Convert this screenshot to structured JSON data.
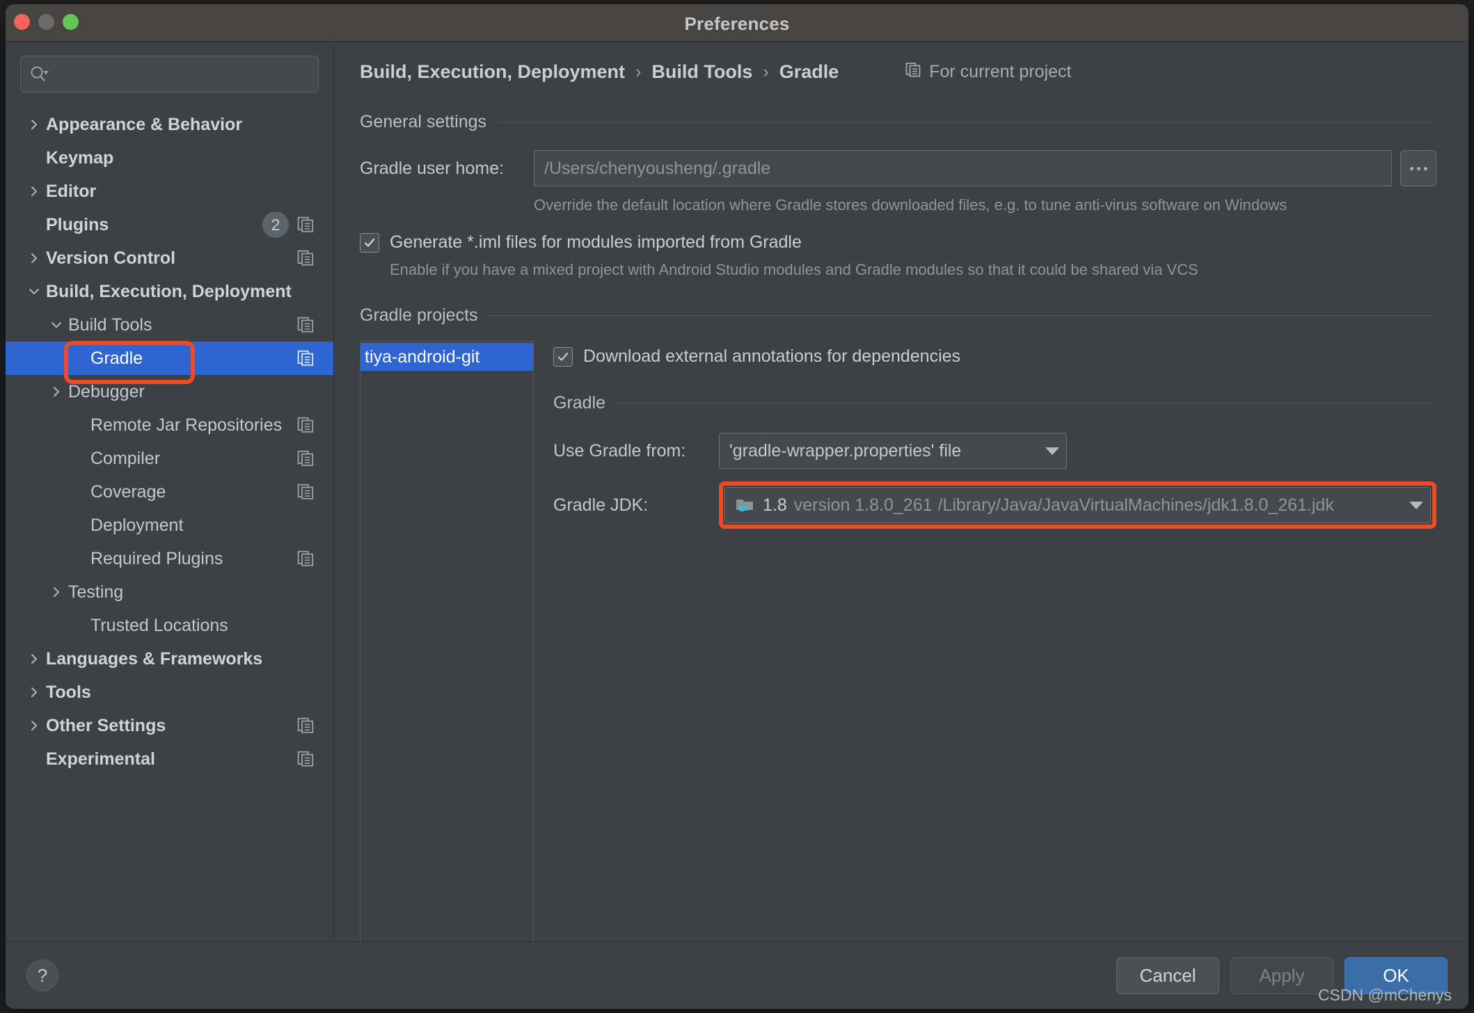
{
  "window": {
    "title": "Preferences",
    "traffic_lights": [
      "close-red",
      "minimize-gray",
      "zoom-green"
    ]
  },
  "sidebar": {
    "search": {
      "placeholder": "",
      "value": "",
      "icon": "search-icon"
    },
    "items": [
      {
        "label": "Appearance & Behavior",
        "arrow": "right",
        "indent": 0,
        "bold": true,
        "copy_icon": false,
        "badge": null,
        "selected": false
      },
      {
        "label": "Keymap",
        "arrow": "none",
        "indent": 0,
        "bold": true,
        "copy_icon": false,
        "badge": null,
        "selected": false
      },
      {
        "label": "Editor",
        "arrow": "right",
        "indent": 0,
        "bold": true,
        "copy_icon": false,
        "badge": null,
        "selected": false
      },
      {
        "label": "Plugins",
        "arrow": "none",
        "indent": 0,
        "bold": true,
        "copy_icon": true,
        "badge": "2",
        "selected": false
      },
      {
        "label": "Version Control",
        "arrow": "right",
        "indent": 0,
        "bold": true,
        "copy_icon": true,
        "badge": null,
        "selected": false
      },
      {
        "label": "Build, Execution, Deployment",
        "arrow": "down",
        "indent": 0,
        "bold": true,
        "copy_icon": false,
        "badge": null,
        "selected": false
      },
      {
        "label": "Build Tools",
        "arrow": "down",
        "indent": 1,
        "bold": false,
        "copy_icon": true,
        "badge": null,
        "selected": false
      },
      {
        "label": "Gradle",
        "arrow": "none",
        "indent": 2,
        "bold": false,
        "copy_icon": true,
        "badge": null,
        "selected": true
      },
      {
        "label": "Debugger",
        "arrow": "right",
        "indent": 1,
        "bold": false,
        "copy_icon": false,
        "badge": null,
        "selected": false
      },
      {
        "label": "Remote Jar Repositories",
        "arrow": "none",
        "indent": 2,
        "bold": false,
        "copy_icon": true,
        "badge": null,
        "selected": false
      },
      {
        "label": "Compiler",
        "arrow": "none",
        "indent": 2,
        "bold": false,
        "copy_icon": true,
        "badge": null,
        "selected": false
      },
      {
        "label": "Coverage",
        "arrow": "none",
        "indent": 2,
        "bold": false,
        "copy_icon": true,
        "badge": null,
        "selected": false
      },
      {
        "label": "Deployment",
        "arrow": "none",
        "indent": 2,
        "bold": false,
        "copy_icon": false,
        "badge": null,
        "selected": false
      },
      {
        "label": "Required Plugins",
        "arrow": "none",
        "indent": 2,
        "bold": false,
        "copy_icon": true,
        "badge": null,
        "selected": false
      },
      {
        "label": "Testing",
        "arrow": "right",
        "indent": 1,
        "bold": false,
        "copy_icon": false,
        "badge": null,
        "selected": false
      },
      {
        "label": "Trusted Locations",
        "arrow": "none",
        "indent": 2,
        "bold": false,
        "copy_icon": false,
        "badge": null,
        "selected": false
      },
      {
        "label": "Languages & Frameworks",
        "arrow": "right",
        "indent": 0,
        "bold": true,
        "copy_icon": false,
        "badge": null,
        "selected": false
      },
      {
        "label": "Tools",
        "arrow": "right",
        "indent": 0,
        "bold": true,
        "copy_icon": false,
        "badge": null,
        "selected": false
      },
      {
        "label": "Other Settings",
        "arrow": "right",
        "indent": 0,
        "bold": true,
        "copy_icon": true,
        "badge": null,
        "selected": false
      },
      {
        "label": "Experimental",
        "arrow": "none",
        "indent": 0,
        "bold": true,
        "copy_icon": true,
        "badge": null,
        "selected": false
      }
    ]
  },
  "main": {
    "breadcrumb": {
      "crumbs": [
        "Build, Execution, Deployment",
        "Build Tools",
        "Gradle"
      ],
      "separator": "›",
      "scope_label": "For current project",
      "scope_icon": "copy-documents-icon"
    },
    "general_settings": {
      "section_title": "General settings",
      "gradle_user_home": {
        "label": "Gradle user home:",
        "value": "",
        "placeholder": "/Users/chenyousheng/.gradle",
        "browse_button": "...",
        "hint": "Override the default location where Gradle stores downloaded files, e.g. to tune anti-virus software on Windows"
      },
      "generate_iml": {
        "label": "Generate *.iml files for modules imported from Gradle",
        "checked": true,
        "hint": "Enable if you have a mixed project with Android Studio modules and Gradle modules so that it could be shared via VCS"
      }
    },
    "gradle_projects": {
      "section_title": "Gradle projects",
      "project_list": [
        "tiya-android-git"
      ],
      "selected_project": "tiya-android-git",
      "download_annotations": {
        "label": "Download external annotations for dependencies",
        "checked": true
      },
      "gradle_section": {
        "section_title": "Gradle",
        "use_gradle_from": {
          "label": "Use Gradle from:",
          "value": "'gradle-wrapper.properties' file"
        },
        "gradle_jdk": {
          "label": "Gradle JDK:",
          "icon": "jdk-folder-coffee-icon",
          "version_short": "1.8",
          "version_full": "version 1.8.0_261",
          "path": "/Library/Java/JavaVirtualMachines/jdk1.8.0_261.jdk",
          "highlighted": true
        }
      }
    }
  },
  "footer": {
    "help_label": "?",
    "cancel_label": "Cancel",
    "apply_label": "Apply",
    "ok_label": "OK",
    "watermark": "CSDN @mChenys"
  },
  "colors": {
    "window_bg": "#3c4145",
    "titlebar_bg": "#484442",
    "selection_blue": "#2f65d0",
    "highlight_red": "#ef4a23",
    "primary_button": "#3b6ea8",
    "text_primary": "#c3c8cc",
    "text_muted": "#8f9499"
  }
}
